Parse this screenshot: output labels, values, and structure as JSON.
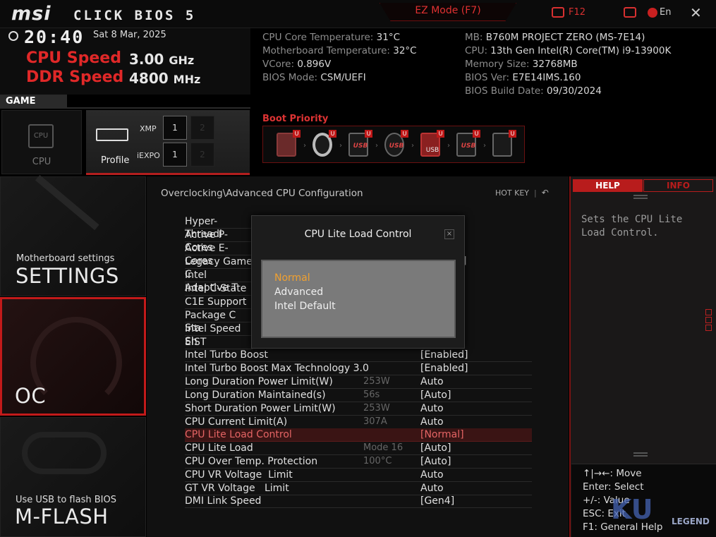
{
  "header": {
    "logo": "msi",
    "bios_name": "CLICK BIOS 5",
    "ez_mode": "EZ Mode (F7)",
    "f12": "F12",
    "language": "En"
  },
  "status": {
    "time": "20:40",
    "date": "Sat  8 Mar, 2025",
    "cpu_speed_label": "CPU Speed",
    "cpu_speed_value": "3.00",
    "cpu_speed_unit": "GHz",
    "ddr_speed_label": "DDR Speed",
    "ddr_speed_value": "4800",
    "ddr_speed_unit": "MHz"
  },
  "sysinfo": {
    "left": [
      {
        "label": "CPU Core Temperature:",
        "value": "31°C"
      },
      {
        "label": "Motherboard Temperature:",
        "value": "32°C"
      },
      {
        "label": "VCore:",
        "value": "0.896V"
      },
      {
        "label": "BIOS Mode:",
        "value": "CSM/UEFI"
      }
    ],
    "right": [
      {
        "label": "MB:",
        "value": "B760M PROJECT ZERO (MS-7E14)"
      },
      {
        "label": "CPU:",
        "value": "13th Gen Intel(R) Core(TM) i9-13900K"
      },
      {
        "label": "Memory Size:",
        "value": "32768MB"
      },
      {
        "label": "BIOS Ver:",
        "value": "E7E14IMS.160"
      },
      {
        "label": "BIOS Build Date:",
        "value": "09/30/2024"
      }
    ]
  },
  "game_boost": {
    "label": "GAME BOOST",
    "cpu_label": "CPU",
    "cpu_chip": "CPU",
    "profile_label": "Profile",
    "xmp_label": "XMP",
    "iexpo_label": "iEXPO",
    "xmp_slots": [
      "1",
      "2"
    ],
    "iexpo_slots": [
      "1",
      "2"
    ]
  },
  "boot": {
    "title": "Boot Priority",
    "devices": [
      {
        "icon": "hdd-icon",
        "text": "",
        "badge": "U"
      },
      {
        "icon": "optical-disc-icon",
        "text": "",
        "badge": "U"
      },
      {
        "icon": "usb-hdd-icon",
        "text": "USB",
        "badge": "U"
      },
      {
        "icon": "usb-cd-icon",
        "text": "USB",
        "badge": "U"
      },
      {
        "icon": "usb-key-icon",
        "text": "USB",
        "badge": "U"
      },
      {
        "icon": "usb-floppy-icon",
        "text": "USB",
        "badge": "U"
      },
      {
        "icon": "network-icon",
        "text": "",
        "badge": "U"
      }
    ]
  },
  "nav": {
    "settings_sub": "Motherboard settings",
    "settings": "SETTINGS",
    "oc": "OC",
    "mflash_sub": "Use USB to flash BIOS",
    "mflash": "M-FLASH"
  },
  "main": {
    "breadcrumb": "Overclocking\\Advanced CPU Configuration",
    "hotkey": "HOT KEY",
    "rows": [
      {
        "name": "Hyper-Threadi",
        "mid": "",
        "value": ""
      },
      {
        "name": "Active P-Cores",
        "mid": "",
        "value": ""
      },
      {
        "name": "Active E-Cores",
        "mid": "",
        "value": ""
      },
      {
        "name": "Legacy Game C",
        "mid": "",
        "value": "]"
      },
      {
        "name": "Intel Adaptive T",
        "mid": "",
        "value": ""
      },
      {
        "name": "Intel C-State",
        "mid": "",
        "value": ""
      },
      {
        "name": "C1E Support",
        "mid": "",
        "value": ""
      },
      {
        "name": "Package C Sta",
        "mid": "",
        "value": ""
      },
      {
        "name": "Intel Speed Sh",
        "mid": "",
        "value": ""
      },
      {
        "name": "EIST",
        "mid": "",
        "value": ""
      },
      {
        "name": "Intel Turbo Boost",
        "mid": "",
        "value": "[Enabled]"
      },
      {
        "name": "Intel Turbo Boost Max Technology 3.0",
        "mid": "",
        "value": "[Enabled]"
      },
      {
        "name": "Long Duration Power Limit(W)",
        "mid": "253W",
        "value": "Auto"
      },
      {
        "name": "Long Duration Maintained(s)",
        "mid": "56s",
        "value": "[Auto]"
      },
      {
        "name": "Short Duration Power Limit(W)",
        "mid": "253W",
        "value": "Auto"
      },
      {
        "name": "CPU Current Limit(A)",
        "mid": "307A",
        "value": "Auto"
      },
      {
        "name": "CPU Lite Load Control",
        "mid": "",
        "value": "[Normal]"
      },
      {
        "name": "CPU Lite Load",
        "mid": "Mode 16",
        "value": "[Auto]"
      },
      {
        "name": "CPU Over Temp. Protection",
        "mid": "100°C",
        "value": "[Auto]"
      },
      {
        "name": "CPU VR Voltage  Limit",
        "mid": "",
        "value": "Auto"
      },
      {
        "name": "GT VR Voltage   Limit",
        "mid": "",
        "value": "Auto"
      },
      {
        "name": "DMI Link Speed",
        "mid": "",
        "value": "[Gen4]"
      }
    ]
  },
  "dialog": {
    "title": "CPU Lite Load Control",
    "close": "×",
    "options": [
      "Normal",
      "Advanced",
      "Intel Default"
    ],
    "selected": "Normal"
  },
  "help": {
    "help_tab": "HELP",
    "info_tab": "INFO",
    "text": "Sets the CPU Lite Load Control.",
    "keys": [
      "↑|→←: Move",
      "Enter: Select",
      "+/-: Value",
      "ESC: Exit",
      "F1: General Help"
    ]
  },
  "watermark": {
    "mark": "KU",
    "text": "LEGEND"
  }
}
